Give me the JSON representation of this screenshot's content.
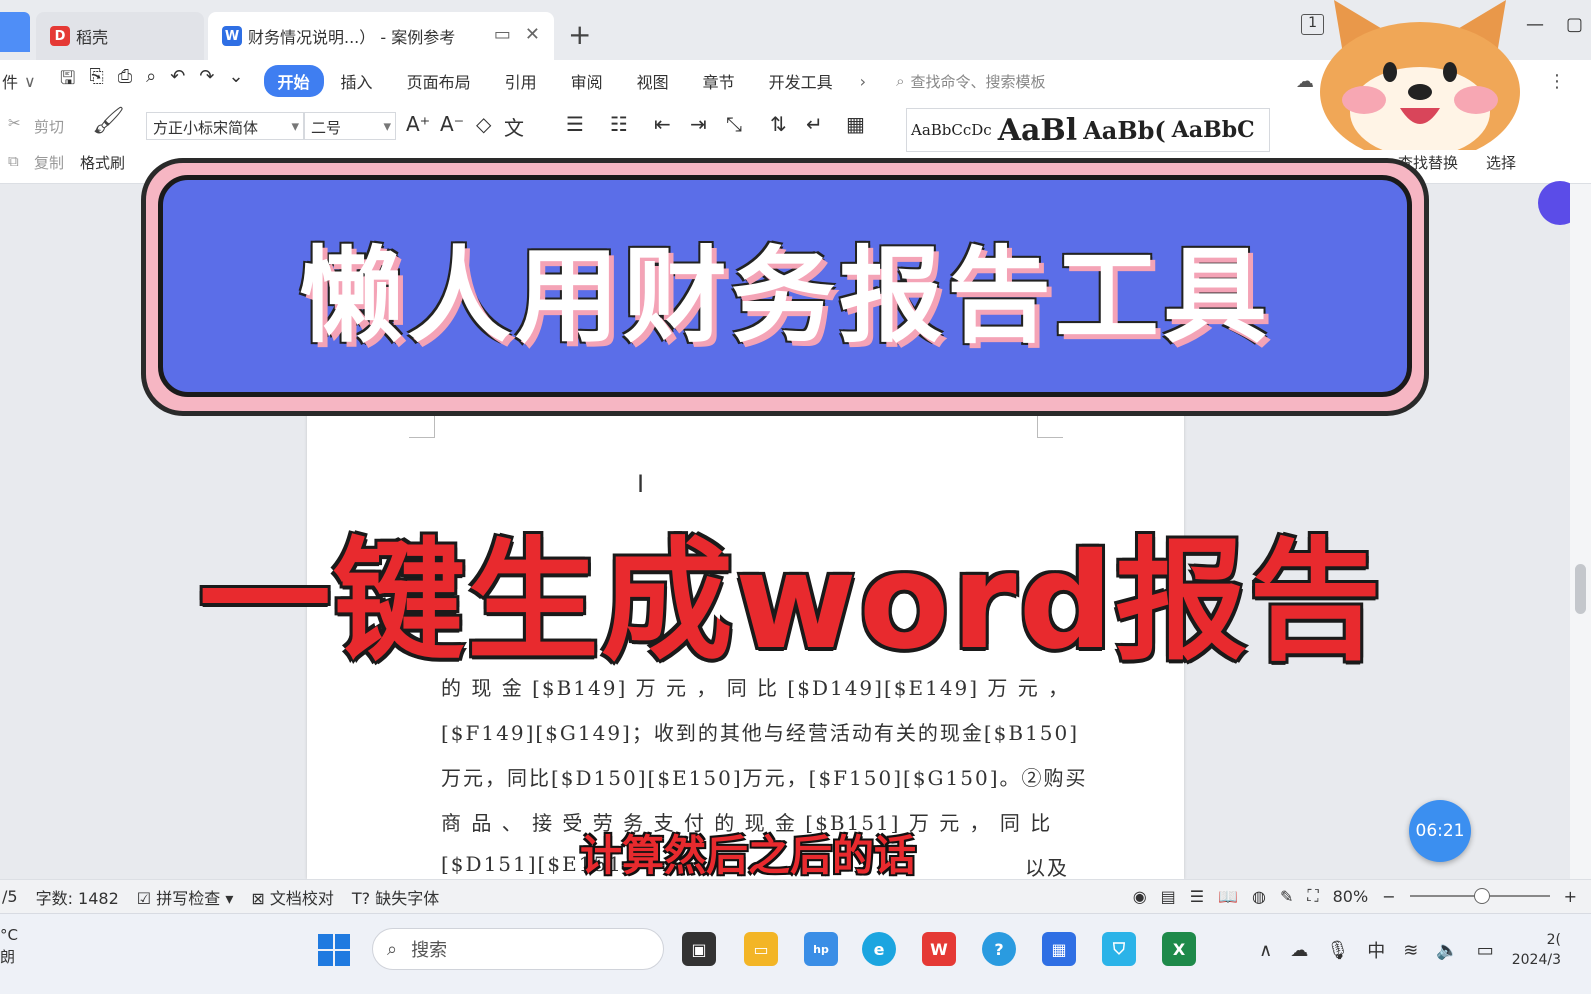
{
  "tabs": [
    {
      "label": "稻壳"
    },
    {
      "label": "财务情况说明...）  - 案例参考"
    }
  ],
  "quick_access": {
    "file_label": "件"
  },
  "menu": {
    "items": [
      "开始",
      "插入",
      "页面布局",
      "引用",
      "审阅",
      "视图",
      "章节",
      "开发工具"
    ],
    "search_placeholder": "查找命令、搜索模板"
  },
  "ribbon": {
    "cut": "剪切",
    "copy": "复制",
    "format_painter": "格式刷",
    "font_name": "方正小标宋简体",
    "font_size": "二号",
    "styles": [
      "AaBbCcDc",
      "AaBl",
      "AaBb(",
      "AaBbC"
    ],
    "find_replace": "查找替换",
    "select": "选择"
  },
  "document": {
    "lines": [
      "的 现 金 [$B149] 万 元 ， 同 比 [$D149][$E149] 万 元 ，",
      "[$F149][$G149]；收到的其他与经营活动有关的现金[$B150]",
      "万元，同比[$D150][$E150]万元，[$F150][$G150]。②购买",
      "商 品 、 接 受 劳 务 支 付 的 现 金 [$B151] 万 元 ， 同 比",
      "[$D151][$E151",
      "以及"
    ]
  },
  "overlay": {
    "banner_title": "懒人用财务报告工具",
    "big_text": "一键生成word报告",
    "subtitle": "计算然后之后的话",
    "timer": "06:21"
  },
  "statusbar": {
    "page": "/5",
    "word_count": "字数: 1482",
    "spell_check": "拼写检查",
    "doc_proof": "文档校对",
    "missing_font": "缺失字体",
    "zoom": "80%",
    "zoom_fraction": 0.8
  },
  "taskbar": {
    "search_placeholder": "搜索",
    "weather_unit": "°C",
    "weather_desc": "朗",
    "ime": "中",
    "date_partial": "2024/3",
    "time_partial": "2("
  },
  "window": {
    "page_indicator": "1"
  },
  "colors": {
    "accent_blue": "#3f7ef1",
    "banner_blue": "#5b6ee8",
    "banner_pink": "#f6b6c3",
    "headline_red": "#e82a2e"
  }
}
